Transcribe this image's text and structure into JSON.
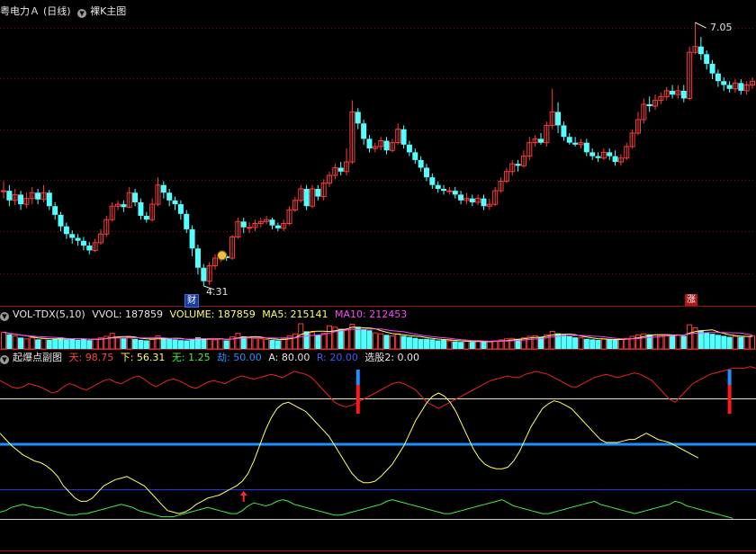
{
  "main_header": {
    "stock_name": "粤电力Ａ",
    "period": "(日线)",
    "overlay": "裸K主图"
  },
  "main_panel": {
    "high_label": "7.05",
    "low_label": "4.31",
    "tag_cai": "财",
    "tag_zhang": "涨"
  },
  "vol_header": {
    "name": "VOL-TDX(5,10)",
    "vvol": "VVOL: 187859",
    "volume": "VOLUME: 187859",
    "ma5": "MA5: 215141",
    "ma10": "MA10: 212453"
  },
  "ind_header": {
    "name": "起爆点副图",
    "tian": "天: 98.75",
    "xia": "下: 56.31",
    "wu": "无: 1.25",
    "jie": "劫: 50.00",
    "a": "A: 80.00",
    "r": "R: 20.00",
    "xuan": "选股2: 0.00"
  },
  "colors": {
    "up": "#ff3b3b",
    "down": "#54ffff",
    "grid": "#6e1010",
    "yellow": "#ffff66",
    "ma10": "#ff44ff",
    "blue_line": "#1e90ff",
    "green": "#44ee44",
    "red_line": "#ee2222"
  },
  "chart_data": {
    "type": "candlestick",
    "price_range": [
      4.31,
      7.05
    ],
    "candles": [
      [
        5.3,
        5.3,
        5.4,
        5.22
      ],
      [
        5.3,
        5.2,
        5.36,
        5.14
      ],
      [
        5.2,
        5.26,
        5.32,
        5.15
      ],
      [
        5.26,
        5.16,
        5.3,
        5.1
      ],
      [
        5.16,
        5.22,
        5.28,
        5.12
      ],
      [
        5.22,
        5.28,
        5.34,
        5.16
      ],
      [
        5.28,
        5.21,
        5.32,
        5.16
      ],
      [
        5.21,
        5.28,
        5.36,
        5.18
      ],
      [
        5.28,
        5.14,
        5.31,
        5.1
      ],
      [
        5.14,
        5.05,
        5.18,
        5.0
      ],
      [
        5.05,
        4.93,
        5.08,
        4.88
      ],
      [
        4.93,
        4.85,
        4.97,
        4.8
      ],
      [
        4.85,
        4.81,
        4.89,
        4.75
      ],
      [
        4.81,
        4.78,
        4.85,
        4.73
      ],
      [
        4.78,
        4.73,
        4.82,
        4.68
      ],
      [
        4.73,
        4.68,
        4.77,
        4.64
      ],
      [
        4.68,
        4.76,
        4.8,
        4.66
      ],
      [
        4.76,
        4.85,
        4.9,
        4.74
      ],
      [
        4.85,
        5.0,
        5.04,
        4.82
      ],
      [
        5.0,
        5.14,
        5.18,
        4.98
      ],
      [
        5.14,
        5.16,
        5.2,
        5.1
      ],
      [
        5.16,
        5.13,
        5.2,
        5.08
      ],
      [
        5.13,
        5.28,
        5.34,
        5.12
      ],
      [
        5.28,
        5.18,
        5.32,
        5.14
      ],
      [
        5.18,
        5.04,
        5.22,
        5.0
      ],
      [
        5.04,
        5.0,
        5.08,
        4.97
      ],
      [
        5.0,
        5.16,
        5.22,
        4.98
      ],
      [
        5.16,
        5.36,
        5.44,
        5.14
      ],
      [
        5.36,
        5.28,
        5.4,
        5.22
      ],
      [
        5.28,
        5.2,
        5.32,
        5.14
      ],
      [
        5.2,
        5.16,
        5.24,
        5.1
      ],
      [
        5.16,
        5.06,
        5.2,
        5.0
      ],
      [
        5.06,
        4.9,
        5.1,
        4.86
      ],
      [
        4.9,
        4.7,
        4.94,
        4.62
      ],
      [
        4.7,
        4.5,
        4.74,
        4.43
      ],
      [
        4.5,
        4.36,
        4.54,
        4.31
      ],
      [
        4.36,
        4.52,
        4.56,
        4.32
      ],
      [
        4.52,
        4.6,
        4.64,
        4.48
      ],
      [
        4.6,
        4.62,
        4.66,
        4.56
      ],
      [
        4.62,
        4.6,
        4.65,
        4.57
      ],
      [
        4.6,
        4.82,
        4.84,
        4.58
      ],
      [
        4.82,
        4.98,
        5.02,
        4.8
      ],
      [
        4.98,
        4.92,
        5.02,
        4.86
      ],
      [
        4.92,
        4.92,
        4.97,
        4.86
      ],
      [
        4.92,
        4.96,
        5.0,
        4.88
      ],
      [
        4.96,
        4.98,
        5.02,
        4.92
      ],
      [
        4.98,
        5.0,
        5.04,
        4.95
      ],
      [
        5.0,
        4.94,
        5.02,
        4.9
      ],
      [
        4.94,
        4.91,
        4.97,
        4.88
      ],
      [
        4.91,
        4.96,
        5.0,
        4.88
      ],
      [
        4.96,
        5.1,
        5.14,
        4.94
      ],
      [
        5.1,
        5.2,
        5.24,
        5.08
      ],
      [
        5.2,
        5.32,
        5.36,
        5.18
      ],
      [
        5.32,
        5.14,
        5.36,
        5.1
      ],
      [
        5.14,
        5.32,
        5.36,
        5.12
      ],
      [
        5.32,
        5.24,
        5.36,
        5.2
      ],
      [
        5.24,
        5.38,
        5.42,
        5.2
      ],
      [
        5.38,
        5.46,
        5.5,
        5.34
      ],
      [
        5.46,
        5.54,
        5.58,
        5.42
      ],
      [
        5.54,
        5.5,
        5.6,
        5.46
      ],
      [
        5.5,
        5.6,
        5.74,
        5.46
      ],
      [
        5.6,
        6.12,
        6.24,
        5.58
      ],
      [
        6.12,
        6.0,
        6.16,
        5.94
      ],
      [
        6.0,
        5.84,
        6.04,
        5.78
      ],
      [
        5.84,
        5.74,
        5.88,
        5.7
      ],
      [
        5.74,
        5.76,
        5.8,
        5.7
      ],
      [
        5.76,
        5.82,
        5.86,
        5.72
      ],
      [
        5.82,
        5.72,
        5.86,
        5.68
      ],
      [
        5.72,
        5.8,
        5.84,
        5.7
      ],
      [
        5.8,
        5.94,
        6.0,
        5.78
      ],
      [
        5.94,
        5.78,
        5.98,
        5.74
      ],
      [
        5.78,
        5.7,
        5.82,
        5.66
      ],
      [
        5.7,
        5.62,
        5.74,
        5.58
      ],
      [
        5.62,
        5.54,
        5.66,
        5.5
      ],
      [
        5.54,
        5.44,
        5.58,
        5.4
      ],
      [
        5.44,
        5.36,
        5.48,
        5.32
      ],
      [
        5.36,
        5.32,
        5.4,
        5.28
      ],
      [
        5.32,
        5.3,
        5.36,
        5.26
      ],
      [
        5.3,
        5.3,
        5.34,
        5.26
      ],
      [
        5.3,
        5.26,
        5.34,
        5.22
      ],
      [
        5.26,
        5.2,
        5.3,
        5.16
      ],
      [
        5.2,
        5.22,
        5.28,
        5.16
      ],
      [
        5.22,
        5.18,
        5.26,
        5.14
      ],
      [
        5.18,
        5.22,
        5.26,
        5.15
      ],
      [
        5.22,
        5.14,
        5.26,
        5.1
      ],
      [
        5.14,
        5.16,
        5.22,
        5.1
      ],
      [
        5.16,
        5.3,
        5.34,
        5.14
      ],
      [
        5.3,
        5.4,
        5.44,
        5.28
      ],
      [
        5.4,
        5.5,
        5.54,
        5.38
      ],
      [
        5.5,
        5.58,
        5.62,
        5.46
      ],
      [
        5.58,
        5.56,
        5.62,
        5.5
      ],
      [
        5.56,
        5.66,
        5.72,
        5.54
      ],
      [
        5.66,
        5.8,
        5.86,
        5.62
      ],
      [
        5.8,
        5.84,
        5.88,
        5.76
      ],
      [
        5.84,
        5.8,
        5.9,
        5.78
      ],
      [
        5.8,
        5.98,
        6.02,
        5.76
      ],
      [
        5.98,
        6.12,
        6.36,
        5.94
      ],
      [
        6.12,
        5.98,
        6.22,
        5.9
      ],
      [
        5.98,
        5.86,
        6.02,
        5.82
      ],
      [
        5.86,
        5.8,
        5.9,
        5.78
      ],
      [
        5.8,
        5.78,
        5.86,
        5.76
      ],
      [
        5.78,
        5.8,
        5.84,
        5.74
      ],
      [
        5.8,
        5.7,
        5.84,
        5.66
      ],
      [
        5.7,
        5.66,
        5.74,
        5.62
      ],
      [
        5.66,
        5.64,
        5.7,
        5.6
      ],
      [
        5.64,
        5.7,
        5.74,
        5.62
      ],
      [
        5.7,
        5.66,
        5.74,
        5.62
      ],
      [
        5.66,
        5.6,
        5.72,
        5.56
      ],
      [
        5.6,
        5.64,
        5.68,
        5.56
      ],
      [
        5.64,
        5.76,
        5.8,
        5.62
      ],
      [
        5.76,
        5.9,
        5.94,
        5.74
      ],
      [
        5.9,
        6.04,
        6.12,
        5.88
      ],
      [
        6.04,
        6.2,
        6.26,
        6.0
      ],
      [
        6.2,
        6.18,
        6.28,
        6.12
      ],
      [
        6.18,
        6.24,
        6.3,
        6.14
      ],
      [
        6.24,
        6.28,
        6.32,
        6.2
      ],
      [
        6.28,
        6.34,
        6.38,
        6.24
      ],
      [
        6.34,
        6.3,
        6.4,
        6.26
      ],
      [
        6.3,
        6.34,
        6.4,
        6.26
      ],
      [
        6.34,
        6.26,
        6.4,
        6.22
      ],
      [
        6.26,
        6.74,
        6.8,
        6.24
      ],
      [
        6.74,
        6.8,
        7.05,
        6.72
      ],
      [
        6.8,
        6.72,
        6.9,
        6.66
      ],
      [
        6.72,
        6.62,
        6.76,
        6.56
      ],
      [
        6.62,
        6.52,
        6.66,
        6.46
      ],
      [
        6.52,
        6.44,
        6.56,
        6.38
      ],
      [
        6.44,
        6.4,
        6.48,
        6.34
      ],
      [
        6.4,
        6.36,
        6.44,
        6.32
      ],
      [
        6.36,
        6.42,
        6.46,
        6.32
      ],
      [
        6.42,
        6.34,
        6.46,
        6.3
      ],
      [
        6.34,
        6.4,
        6.44,
        6.3
      ],
      [
        6.4,
        6.44,
        6.48,
        6.36
      ]
    ],
    "volume": [
      0.66,
      0.58,
      0.52,
      0.45,
      0.4,
      0.44,
      0.38,
      0.42,
      0.36,
      0.4,
      0.46,
      0.38,
      0.42,
      0.36,
      0.4,
      0.35,
      0.38,
      0.44,
      0.5,
      0.62,
      0.46,
      0.42,
      0.48,
      0.4,
      0.36,
      0.34,
      0.38,
      0.52,
      0.44,
      0.4,
      0.38,
      0.35,
      0.34,
      0.4,
      0.46,
      0.42,
      0.38,
      0.36,
      0.4,
      0.34,
      0.48,
      0.62,
      0.5,
      0.44,
      0.42,
      0.4,
      0.38,
      0.36,
      0.34,
      0.4,
      0.52,
      0.6,
      1.0,
      0.7,
      0.66,
      0.56,
      0.62,
      0.92,
      0.86,
      0.8,
      0.76,
      0.98,
      0.88,
      0.78,
      0.74,
      0.64,
      0.6,
      0.56,
      0.52,
      0.6,
      0.52,
      0.48,
      0.44,
      0.4,
      0.4,
      0.38,
      0.34,
      0.36,
      0.32,
      0.3,
      0.28,
      0.3,
      0.28,
      0.32,
      0.3,
      0.28,
      0.32,
      0.36,
      0.4,
      0.42,
      0.4,
      0.44,
      0.5,
      0.52,
      0.48,
      0.56,
      0.7,
      0.62,
      0.56,
      0.5,
      0.46,
      0.44,
      0.4,
      0.38,
      0.36,
      0.4,
      0.38,
      0.36,
      0.38,
      0.42,
      0.5,
      0.56,
      0.6,
      0.58,
      0.56,
      0.54,
      0.56,
      0.54,
      0.56,
      0.52,
      0.96,
      0.84,
      0.74,
      0.66,
      0.6,
      0.56,
      0.52,
      0.48,
      0.5,
      0.48,
      0.5,
      0.52
    ],
    "indicator": {
      "tian": [
        90,
        88,
        86,
        85,
        86,
        88,
        87,
        86,
        84,
        82,
        83,
        86,
        88,
        87,
        85,
        84,
        86,
        88,
        90,
        91,
        89,
        88,
        90,
        92,
        93,
        91,
        88,
        86,
        88,
        90,
        91,
        90,
        88,
        86,
        85,
        87,
        89,
        90,
        89,
        88,
        90,
        92,
        93,
        92,
        91,
        92,
        93,
        94,
        93,
        92,
        94,
        96,
        95,
        94,
        92,
        88,
        84,
        80,
        76,
        74,
        73,
        74,
        76,
        78,
        80,
        82,
        84,
        86,
        88,
        89,
        88,
        86,
        84,
        80,
        76,
        74,
        72,
        74,
        76,
        78,
        80,
        82,
        84,
        86,
        88,
        90,
        91,
        92,
        93,
        92,
        92,
        94,
        95,
        96,
        95,
        94,
        92,
        90,
        88,
        86,
        86,
        88,
        90,
        92,
        93,
        94,
        93,
        92,
        93,
        94,
        95,
        94,
        92,
        90,
        86,
        82,
        78,
        76,
        80,
        84,
        88,
        90,
        92,
        94,
        95,
        96,
        97,
        98,
        98,
        98,
        99,
        98
      ],
      "xia": [
        56,
        52,
        48,
        45,
        42,
        40,
        38,
        37,
        35,
        32,
        28,
        22,
        18,
        14,
        12,
        12,
        14,
        18,
        22,
        24,
        26,
        27,
        28,
        26,
        24,
        22,
        18,
        14,
        10,
        6,
        5,
        4,
        5,
        7,
        10,
        12,
        14,
        15,
        16,
        18,
        20,
        22,
        25,
        30,
        38,
        48,
        58,
        66,
        72,
        75,
        76,
        74,
        72,
        70,
        66,
        62,
        58,
        54,
        48,
        42,
        36,
        30,
        26,
        24,
        24,
        25,
        28,
        32,
        36,
        42,
        48,
        56,
        64,
        70,
        76,
        80,
        82,
        80,
        76,
        70,
        62,
        54,
        46,
        40,
        36,
        34,
        33,
        33,
        34,
        38,
        44,
        52,
        60,
        66,
        72,
        75,
        77,
        76,
        74,
        72,
        68,
        64,
        60,
        56,
        52,
        50,
        50,
        50,
        51,
        52,
        52,
        54,
        56,
        54,
        52,
        51,
        50,
        48,
        46,
        44,
        42,
        40
      ],
      "wu": [
        5,
        6,
        8,
        9,
        10,
        9,
        8,
        8,
        7,
        6,
        5,
        4,
        3,
        3,
        4,
        4,
        5,
        6,
        7,
        8,
        9,
        10,
        9,
        8,
        6,
        5,
        4,
        3,
        2,
        2,
        2,
        3,
        4,
        5,
        6,
        7,
        8,
        7,
        6,
        5,
        4,
        4,
        6,
        9,
        11,
        10,
        9,
        10,
        12,
        13,
        12,
        10,
        9,
        8,
        7,
        6,
        5,
        4,
        3,
        3,
        4,
        5,
        6,
        7,
        8,
        9,
        10,
        12,
        13,
        12,
        11,
        10,
        9,
        8,
        7,
        6,
        5,
        4,
        4,
        5,
        6,
        7,
        8,
        9,
        10,
        11,
        12,
        13,
        11,
        9,
        8,
        7,
        6,
        5,
        4,
        4,
        5,
        6,
        7,
        8,
        9,
        10,
        11,
        12,
        10,
        9,
        8,
        7,
        6,
        5,
        4,
        5,
        6,
        7,
        8,
        9,
        10,
        12,
        11,
        9,
        8,
        7,
        6,
        5,
        4,
        3,
        2,
        1
      ]
    },
    "markers": [
      {
        "type": "signal",
        "x_index": 62
      },
      {
        "type": "signal",
        "x_index": 127
      },
      {
        "type": "arrow",
        "x_index": 42
      }
    ]
  }
}
